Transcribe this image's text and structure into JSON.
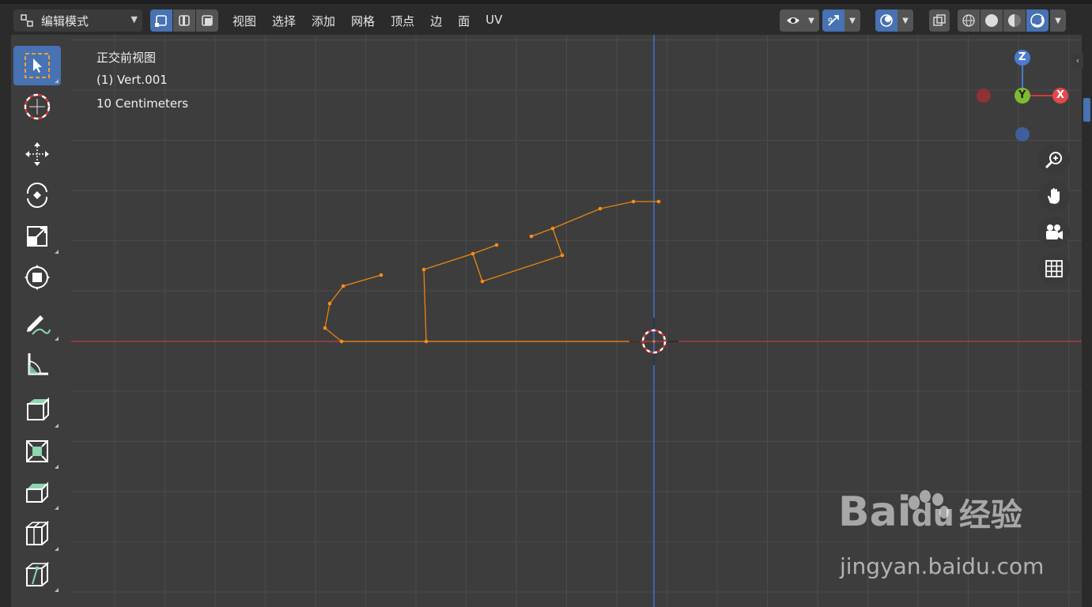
{
  "header": {
    "mode_label": "编辑模式",
    "menu": [
      "视图",
      "选择",
      "添加",
      "网格",
      "顶点",
      "边",
      "面",
      "UV"
    ]
  },
  "viewport": {
    "view_name": "正交前视图",
    "object_info": "(1) Vert.001",
    "scale": "10 Centimeters"
  },
  "gizmo": {
    "z": "Z",
    "y": "Y",
    "x": "X"
  },
  "watermark": {
    "brand": "Bai",
    "brand2": "du",
    "cn": "经验",
    "url": "jingyan.baidu.com"
  },
  "colors": {
    "accent": "#4772b3",
    "edge": "#e8850f",
    "x_axis": "#d9383b",
    "z_axis": "#4a7bd0",
    "y_axis": "#7dbb2f"
  }
}
